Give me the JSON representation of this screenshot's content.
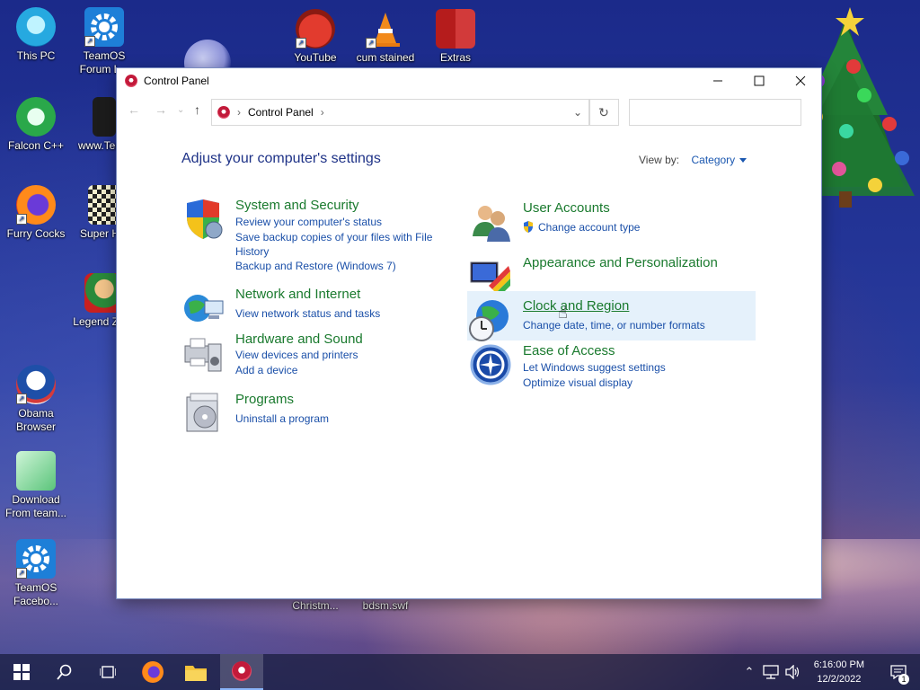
{
  "desktop": {
    "icons": [
      {
        "label": "This PC"
      },
      {
        "label": "TeamOS Forum L..."
      },
      {
        "label": "YouTube"
      },
      {
        "label": "cum stained"
      },
      {
        "label": "Extras"
      },
      {
        "label": "Falcon C++"
      },
      {
        "label": "www.Tea..."
      },
      {
        "label": "Furry Cocks"
      },
      {
        "label": "Super H..."
      },
      {
        "label": "Legend Zilda"
      },
      {
        "label": "Obama Browser"
      },
      {
        "label": "Download From team..."
      },
      {
        "label": "TeamOS Facebo..."
      },
      {
        "label": "Christm..."
      },
      {
        "label": "bdsm.swf"
      }
    ]
  },
  "window": {
    "title": "Control Panel",
    "address": {
      "path": "Control Panel",
      "separator": "›"
    },
    "heading": "Adjust your computer's settings",
    "view_by": {
      "label": "View by:",
      "value": "Category"
    },
    "categories_left": [
      {
        "title": "System and Security",
        "links": [
          "Review your computer's status",
          "Save backup copies of your files with File",
          "History",
          "Backup and Restore (Windows 7)"
        ]
      },
      {
        "title": "Network and Internet",
        "links": [
          "View network status and tasks"
        ]
      },
      {
        "title": "Hardware and Sound",
        "links": [
          "View devices and printers",
          "Add a device"
        ]
      },
      {
        "title": "Programs",
        "links": [
          "Uninstall a program"
        ]
      }
    ],
    "categories_right": [
      {
        "title": "User Accounts",
        "links": [
          "Change account type"
        ]
      },
      {
        "title": "Appearance and Personalization",
        "links": []
      },
      {
        "title": "Clock and Region",
        "links": [
          "Change date, time, or number formats"
        ]
      },
      {
        "title": "Ease of Access",
        "links": [
          "Let Windows suggest settings",
          "Optimize visual display"
        ]
      }
    ]
  },
  "taskbar": {
    "time": "6:16:00 PM",
    "date": "12/2/2022",
    "notification_count": "1"
  },
  "colors": {
    "link": "#1a4fa8",
    "category_title": "#1a7a2e",
    "heading": "#1e3287"
  }
}
